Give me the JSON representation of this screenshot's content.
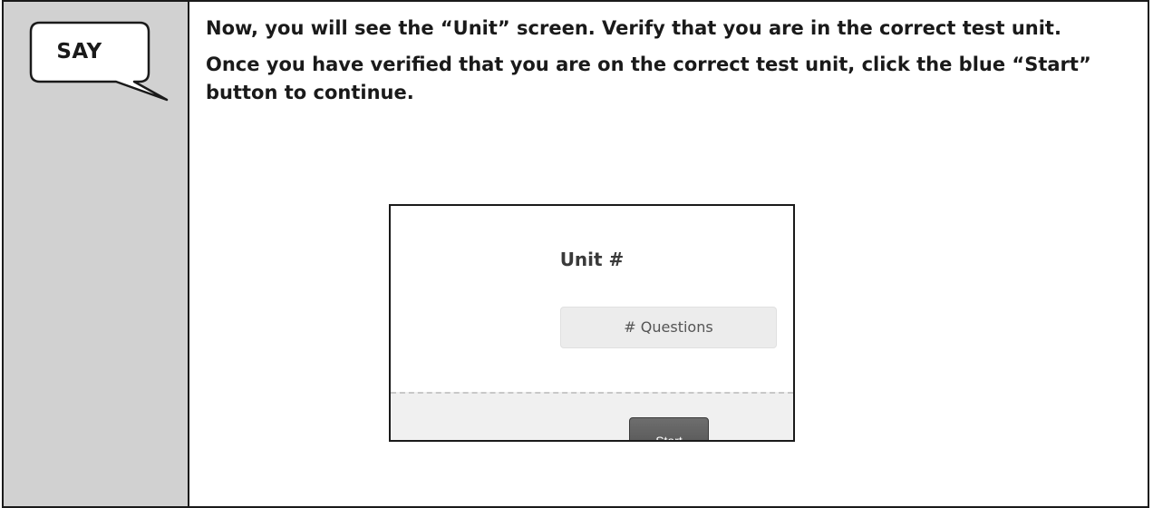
{
  "callout": {
    "label": "SAY"
  },
  "instructions": [
    "Now, you will see the “Unit” screen. Verify that you are in the correct test unit.",
    "Once you have verified that you are on the correct test unit, click the blue “Start” button to continue."
  ],
  "unit_screen": {
    "title": "Unit #",
    "questions_label": "# Questions",
    "start_label": "Start"
  }
}
